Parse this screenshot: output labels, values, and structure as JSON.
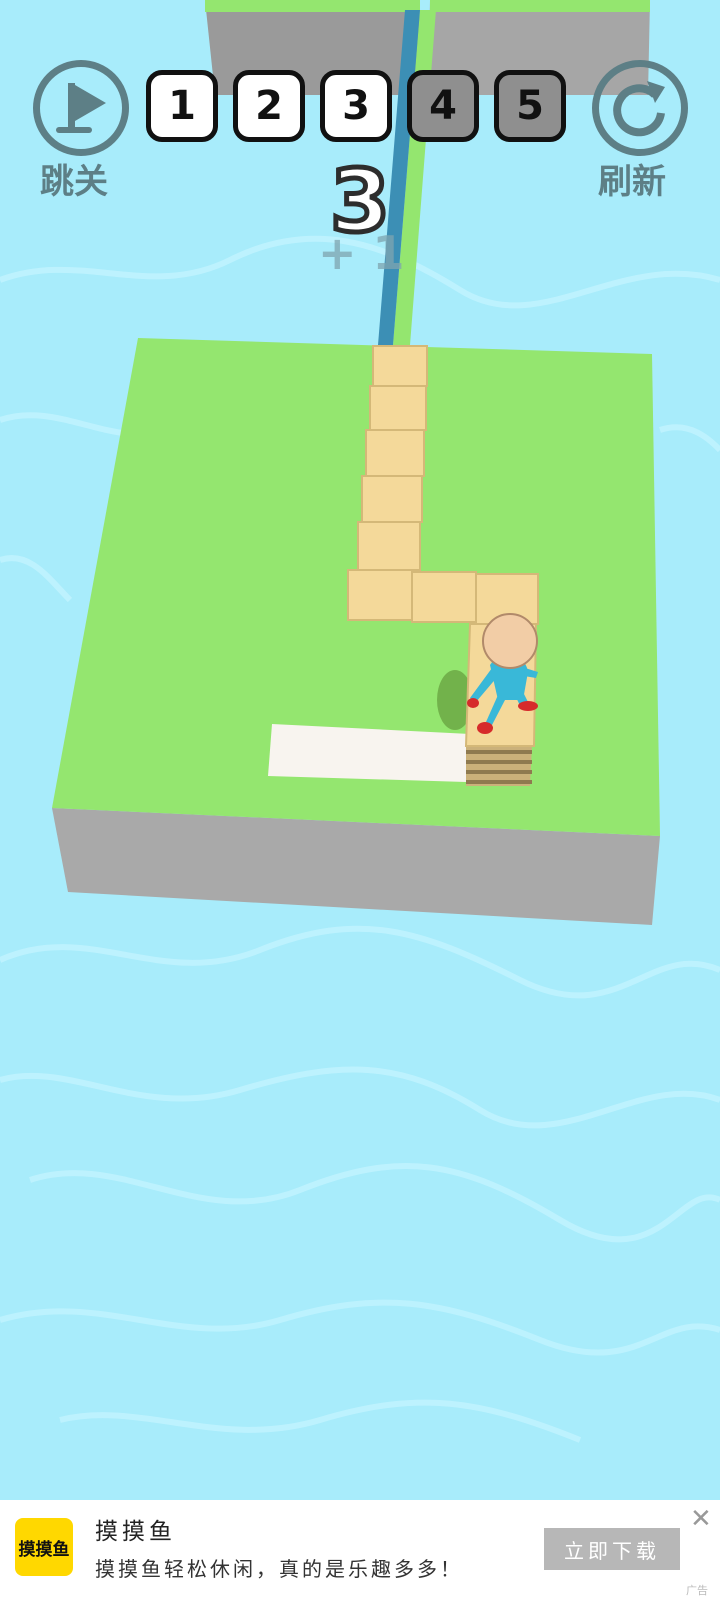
{
  "hud": {
    "skip_label": "跳关",
    "refresh_label": "刷新",
    "levels": [
      {
        "label": "1",
        "completed": true
      },
      {
        "label": "2",
        "completed": true
      },
      {
        "label": "3",
        "completed": true
      },
      {
        "label": "4",
        "completed": false
      },
      {
        "label": "5",
        "completed": false
      }
    ],
    "counter": "3",
    "plus": "+ 1"
  },
  "ad": {
    "logo_text": "摸摸鱼",
    "title": "摸摸鱼",
    "description": "摸摸鱼轻松休闲，真的是乐趣多多！",
    "button": "立即下载",
    "close": "✕",
    "tag": "广告"
  },
  "colors": {
    "water": "#a8ecfb",
    "grass": "#94e66f",
    "tile": "#f4d99a",
    "hud": "#5d7f86",
    "ad_accent": "#ffd800"
  }
}
